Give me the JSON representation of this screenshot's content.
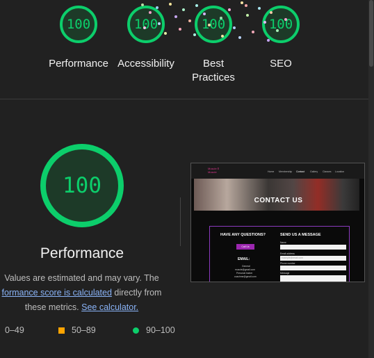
{
  "top_gauges": [
    {
      "score": "100",
      "label": "Performance"
    },
    {
      "score": "100",
      "label": "Accessibility"
    },
    {
      "score": "100",
      "label": "Best Practices"
    },
    {
      "score": "100",
      "label": "SEO"
    }
  ],
  "performance": {
    "score": "100",
    "title": "Performance",
    "desc_prefix": "Values are estimated and may vary. The",
    "link_score": "formance score is calculated",
    "desc_middle": "directly from these metrics.",
    "link_calculator": "See calculator."
  },
  "legend": [
    {
      "range": "0–49",
      "color": "#ff4e42"
    },
    {
      "range": "50–89",
      "color": "#ffa400"
    },
    {
      "range": "90–100",
      "color": "#0cce6b"
    }
  ],
  "preview": {
    "logo_line1": "Muscle Ⅱ",
    "logo_line2": "Muscle",
    "nav": [
      "Home",
      "Membership",
      "Contact",
      "Gallery",
      "Classes",
      "Location"
    ],
    "hero_title": "CONTACT US",
    "left_heading": "HAVE ANY QUESTIONS?",
    "button": "Call Us",
    "email_heading": "EMAIL:",
    "contacts": [
      "General",
      "muscle@gmail.com",
      "Personal trainer",
      "coachme@gmail.com"
    ],
    "right_heading": "SEND US A MESSAGE",
    "fields": [
      "Name",
      "Email address",
      "Phone number",
      "Message"
    ],
    "email_placeholder": "example@email.com"
  }
}
